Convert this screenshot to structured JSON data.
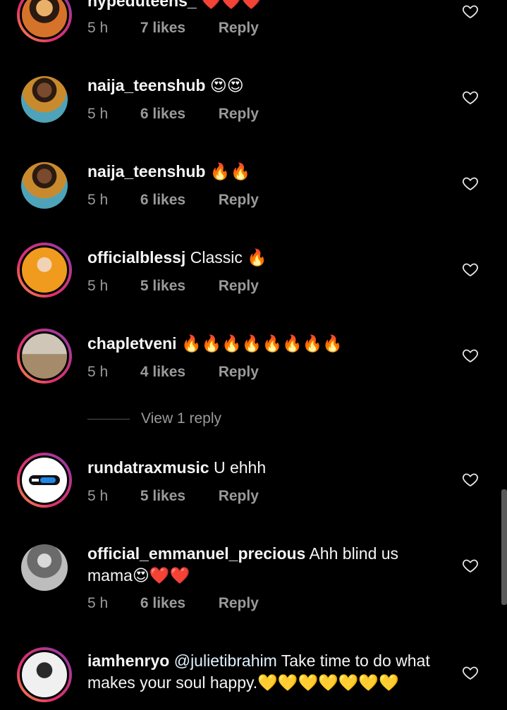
{
  "colors": {
    "background": "#000000",
    "muted": "#9a9a9a",
    "text": "#f5f5f5",
    "story_ring": [
      "#f6a23a",
      "#e1306c",
      "#833ab4"
    ]
  },
  "comments": [
    {
      "username": "hypeduteens_",
      "text": "❤️❤️❤️",
      "time": "5 h",
      "likes": "7 likes",
      "reply": "Reply"
    },
    {
      "username": "naija_teenshub",
      "text": "😍😍",
      "time": "5 h",
      "likes": "6 likes",
      "reply": "Reply"
    },
    {
      "username": "naija_teenshub",
      "text": "🔥🔥",
      "time": "5 h",
      "likes": "6 likes",
      "reply": "Reply"
    },
    {
      "username": "officialblessj",
      "text": "Classic 🔥",
      "time": "5 h",
      "likes": "5 likes",
      "reply": "Reply"
    },
    {
      "username": "chapletveni",
      "text": "🔥🔥🔥🔥🔥🔥🔥🔥",
      "time": "5 h",
      "likes": "4 likes",
      "reply": "Reply"
    },
    {
      "username": "rundatraxmusic",
      "text": "U ehhh",
      "time": "5 h",
      "likes": "5 likes",
      "reply": "Reply"
    },
    {
      "username": "official_emmanuel_precious",
      "text": "Ahh blind us mama😍❤️❤️",
      "time": "5 h",
      "likes": "6 likes",
      "reply": "Reply"
    },
    {
      "username": "iamhenryo",
      "mention": "@julietibrahim",
      "text": "Take time to do what makes your soul happy.💛💛💛💛💛💛💛"
    }
  ],
  "view_replies": "View 1 reply",
  "icons": {
    "like": "heart-outline-icon"
  }
}
